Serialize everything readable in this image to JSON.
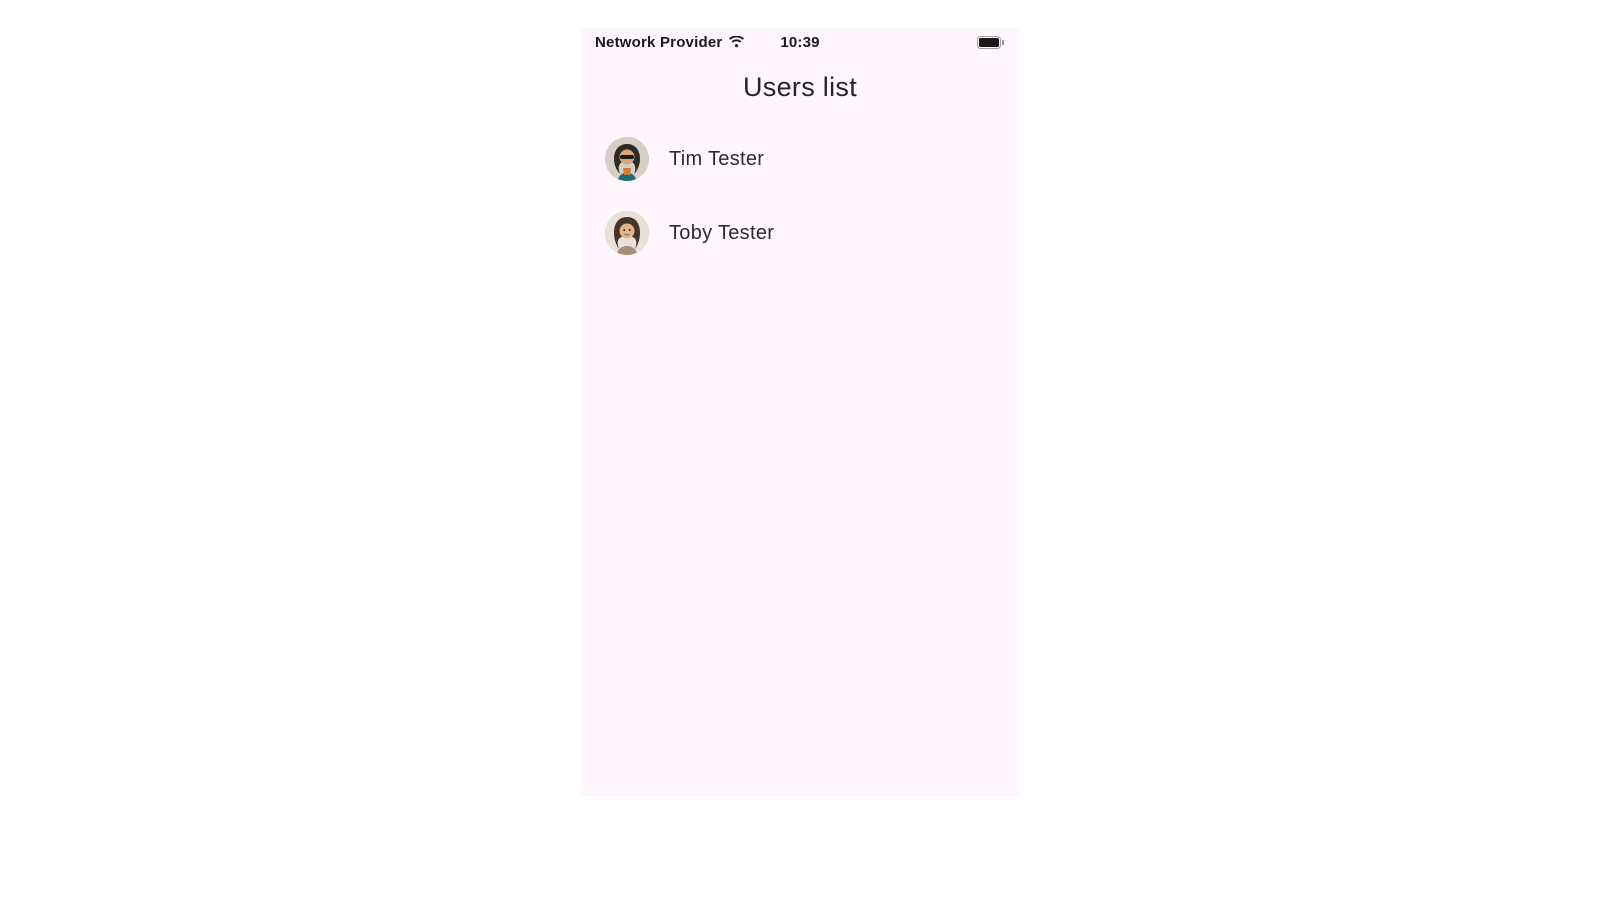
{
  "status_bar": {
    "carrier": "Network Provider",
    "time": "10:39"
  },
  "page": {
    "title": "Users list"
  },
  "users": [
    {
      "name": "Tim Tester"
    },
    {
      "name": "Toby Tester"
    }
  ]
}
